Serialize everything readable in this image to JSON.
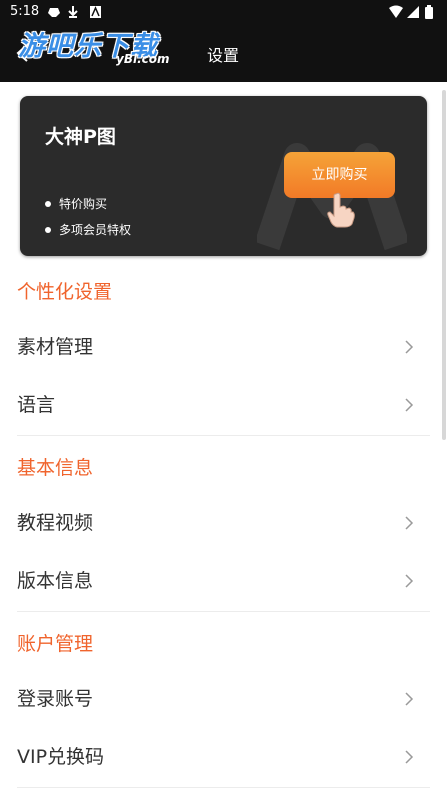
{
  "status_bar": {
    "time": "5:18"
  },
  "watermark": {
    "main": "游吧乐下载",
    "sub": "yBl.com"
  },
  "app_bar": {
    "title": "设置"
  },
  "promo": {
    "title": "大神P图",
    "bullets": [
      "特价购买",
      "多项会员特权"
    ],
    "buy_label": "立即购买"
  },
  "sections": [
    {
      "header": "个性化设置",
      "items": [
        "素材管理",
        "语言"
      ]
    },
    {
      "header": "基本信息",
      "items": [
        "教程视频",
        "版本信息"
      ]
    },
    {
      "header": "账户管理",
      "items": [
        "登录账号",
        "VIP兑换码"
      ]
    }
  ],
  "colors": {
    "accent": "#f0642d",
    "button_gradient_top": "#f5a338",
    "button_gradient_bottom": "#f27a27",
    "appbar": "#111111",
    "card": "#2b2b2b"
  }
}
